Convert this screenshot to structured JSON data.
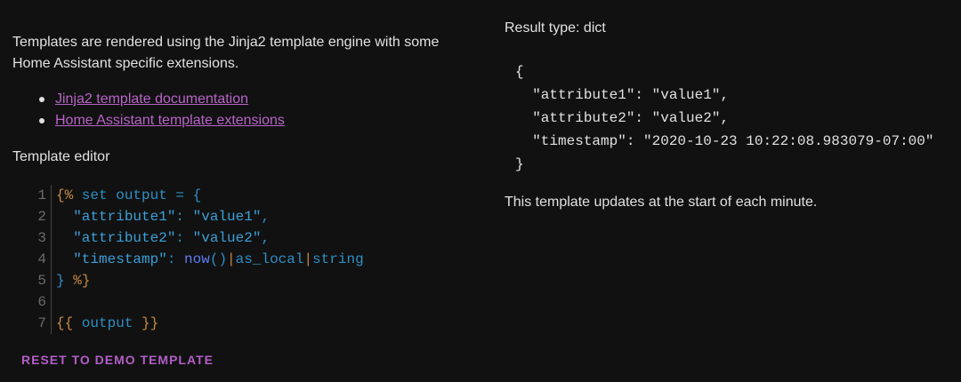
{
  "description": {
    "line1": "Templates are rendered using the Jinja2 template engine with some",
    "line2": "Home Assistant specific extensions."
  },
  "links": [
    {
      "label": "Jinja2 template documentation"
    },
    {
      "label": "Home Assistant template extensions"
    }
  ],
  "editor": {
    "title": "Template editor",
    "line_numbers": [
      "1",
      "2",
      "3",
      "4",
      "5",
      "6",
      "7"
    ],
    "code": {
      "l1_open": "{%",
      "l1_set": " set output = {",
      "l2_key": "  \"attribute1\"",
      "l2_sep": ": ",
      "l2_val": "\"value1\"",
      "l2_end": ",",
      "l3_key": "  \"attribute2\"",
      "l3_sep": ": ",
      "l3_val": "\"value2\"",
      "l3_end": ",",
      "l4_key": "  \"timestamp\"",
      "l4_sep": ": ",
      "l4_fn": "now",
      "l4_paren": "()",
      "l4_pipe1": "|",
      "l4_filter1": "as_local",
      "l4_pipe2": "|",
      "l4_filter2": "string",
      "l5_brace": "}",
      "l5_close": " %}",
      "l6": "",
      "l7_open": "{{",
      "l7_expr": " output ",
      "l7_close": "}}"
    }
  },
  "reset_button": {
    "label": "RESET TO DEMO TEMPLATE"
  },
  "result": {
    "type_label": "Result type: dict",
    "json_text": "{\n  \"attribute1\": \"value1\",\n  \"attribute2\": \"value2\",\n  \"timestamp\": \"2020-10-23 10:22:08.983079-07:00\"\n}",
    "update_note": "This template updates at the start of each minute."
  },
  "colors": {
    "background": "#111111",
    "text": "#e1e1e1",
    "link": "#b864c8",
    "accent_button": "#b25ec7",
    "code_tag": "#c58a43",
    "code_keyword": "#2d8fc4",
    "code_function": "#5e7cf2"
  }
}
